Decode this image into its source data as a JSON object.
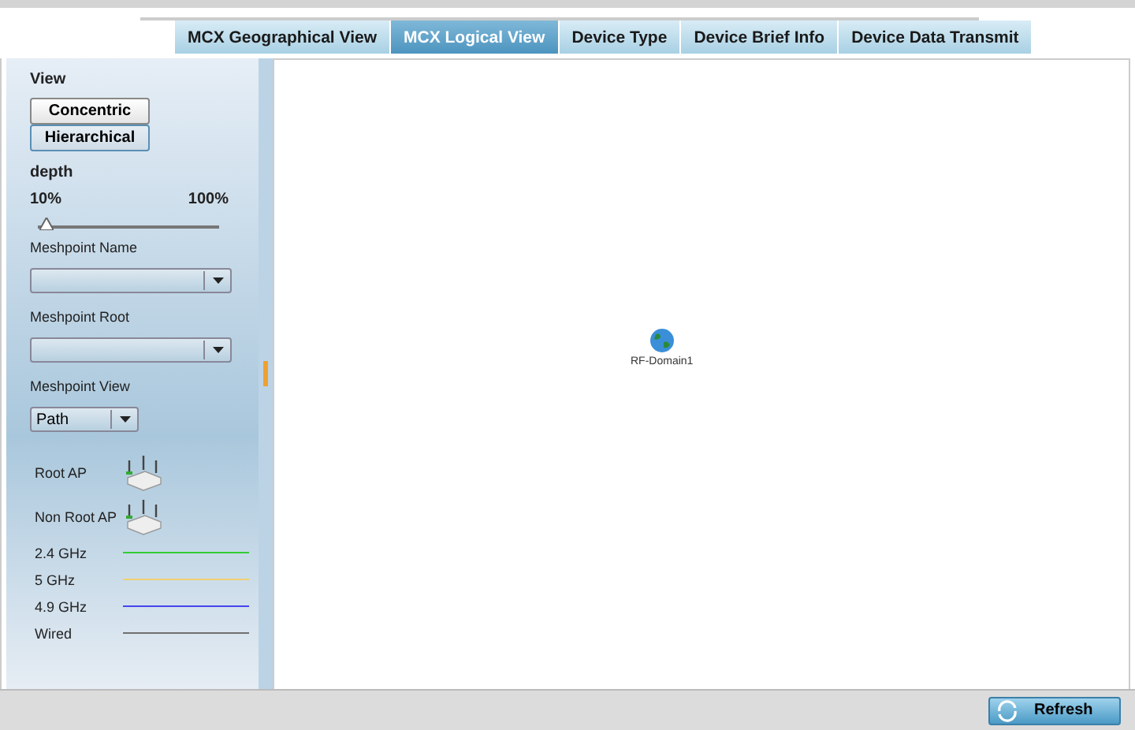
{
  "tabs": [
    {
      "label": "MCX Geographical View",
      "selected": false
    },
    {
      "label": "MCX Logical View",
      "selected": true
    },
    {
      "label": "Device Type",
      "selected": false
    },
    {
      "label": "Device Brief Info",
      "selected": false
    },
    {
      "label": "Device Data Transmit",
      "selected": false
    }
  ],
  "sidebar": {
    "view_label": "View",
    "view_buttons": [
      {
        "label": "Concentric",
        "selected": false
      },
      {
        "label": "Hierarchical",
        "selected": true
      }
    ],
    "depth": {
      "label": "depth",
      "min_label": "10%",
      "max_label": "100%",
      "level": 0.05
    },
    "dropdowns": [
      {
        "label": "Meshpoint Name"
      },
      {
        "label": "Meshpoint Root"
      }
    ],
    "meshpoint_view": {
      "label": "Meshpoint View",
      "value": "Path"
    },
    "legend": [
      {
        "label": "Root AP",
        "kind": "device"
      },
      {
        "label": "Non Root AP",
        "kind": "device"
      },
      {
        "label": "2.4 GHz",
        "kind": "line",
        "color": "#33cc33"
      },
      {
        "label": "5 GHz",
        "kind": "line",
        "color": "#f0d070"
      },
      {
        "label": "4.9 GHz",
        "kind": "line",
        "color": "#4444ee"
      },
      {
        "label": "Wired",
        "kind": "line",
        "color": "#707070"
      }
    ]
  },
  "canvas": {
    "nodes": [
      {
        "label": "RF-Domain1"
      }
    ]
  },
  "footer": {
    "refresh_button": "Refresh"
  }
}
